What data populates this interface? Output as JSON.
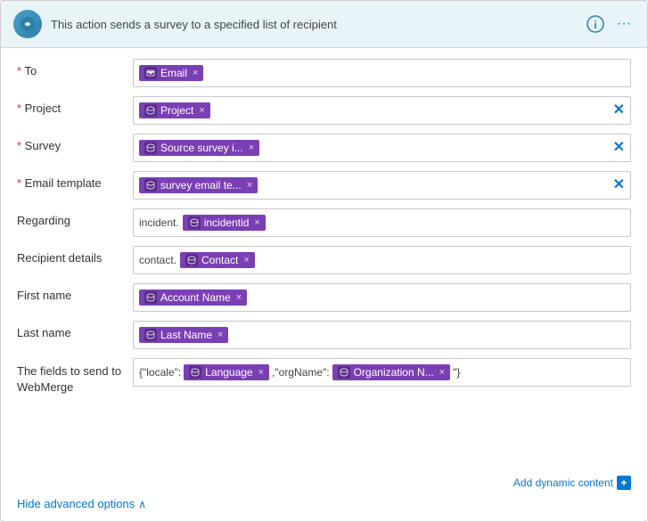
{
  "header": {
    "title": "This action sends a survey to a specified list of recipient",
    "info_icon": "ℹ",
    "more_icon": "···"
  },
  "fields": [
    {
      "label": "To",
      "required": true,
      "tokens": [
        {
          "text": "Email",
          "showClose": true
        }
      ],
      "hasClear": false,
      "type": "simple"
    },
    {
      "label": "Project",
      "required": true,
      "tokens": [
        {
          "text": "Project",
          "showClose": true
        }
      ],
      "hasClear": true,
      "type": "simple"
    },
    {
      "label": "Survey",
      "required": true,
      "tokens": [
        {
          "text": "Source survey i...",
          "showClose": true
        }
      ],
      "hasClear": true,
      "type": "simple"
    },
    {
      "label": "Email template",
      "required": true,
      "tokens": [
        {
          "text": "survey email te...",
          "showClose": true
        }
      ],
      "hasClear": true,
      "type": "simple"
    },
    {
      "label": "Regarding",
      "required": false,
      "prefix": "incident.",
      "tokens": [
        {
          "text": "incidentid",
          "showClose": true
        }
      ],
      "hasClear": false,
      "type": "prefixed"
    },
    {
      "label": "Recipient details",
      "required": false,
      "prefix": "contact.",
      "tokens": [
        {
          "text": "Contact",
          "showClose": true
        }
      ],
      "hasClear": false,
      "type": "prefixed"
    },
    {
      "label": "First name",
      "required": false,
      "tokens": [
        {
          "text": "Account Name",
          "showClose": true
        }
      ],
      "hasClear": false,
      "type": "simple"
    },
    {
      "label": "Last name",
      "required": false,
      "tokens": [
        {
          "text": "Last Name",
          "showClose": true
        }
      ],
      "hasClear": false,
      "type": "simple"
    },
    {
      "label": "The fields to send to WebMerge",
      "required": false,
      "type": "webmerge",
      "parts": [
        {
          "kind": "text",
          "value": "{\"locale\":"
        },
        {
          "kind": "token",
          "text": "Language",
          "showClose": true
        },
        {
          "kind": "text",
          "value": ",\"orgName\":"
        },
        {
          "kind": "token",
          "text": "Organization N...",
          "showClose": true
        },
        {
          "kind": "text",
          "value": "\"}"
        }
      ]
    }
  ],
  "footer": {
    "add_dynamic_label": "Add dynamic content",
    "hide_advanced_label": "Hide advanced options"
  },
  "icons": {
    "db_icon": "🗄",
    "chevron_up": "∧"
  }
}
